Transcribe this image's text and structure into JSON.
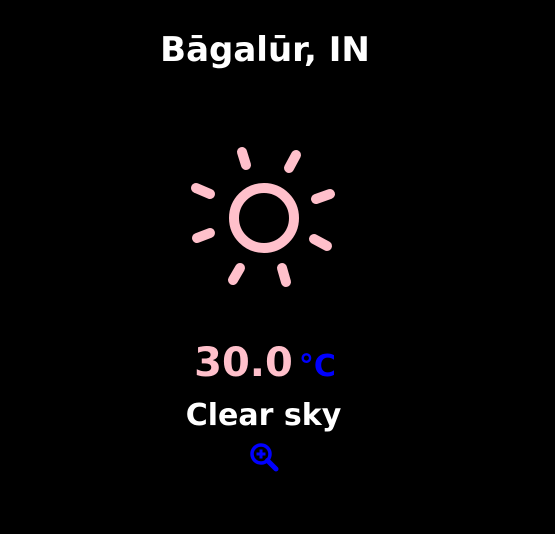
{
  "weather": {
    "location": "Bāgalūr, IN",
    "temperature": "30.0",
    "unit": "°C",
    "condition": "Clear sky"
  },
  "icons": {
    "weather_icon": "sun-icon",
    "detail_icon": "zoom-in-icon"
  },
  "colors": {
    "background": "#000000",
    "text": "#ffffff",
    "sun": "#ffc0cb",
    "temperature": "#ffc0cb",
    "unit": "#0000ff",
    "zoom_icon": "#0000ff"
  }
}
